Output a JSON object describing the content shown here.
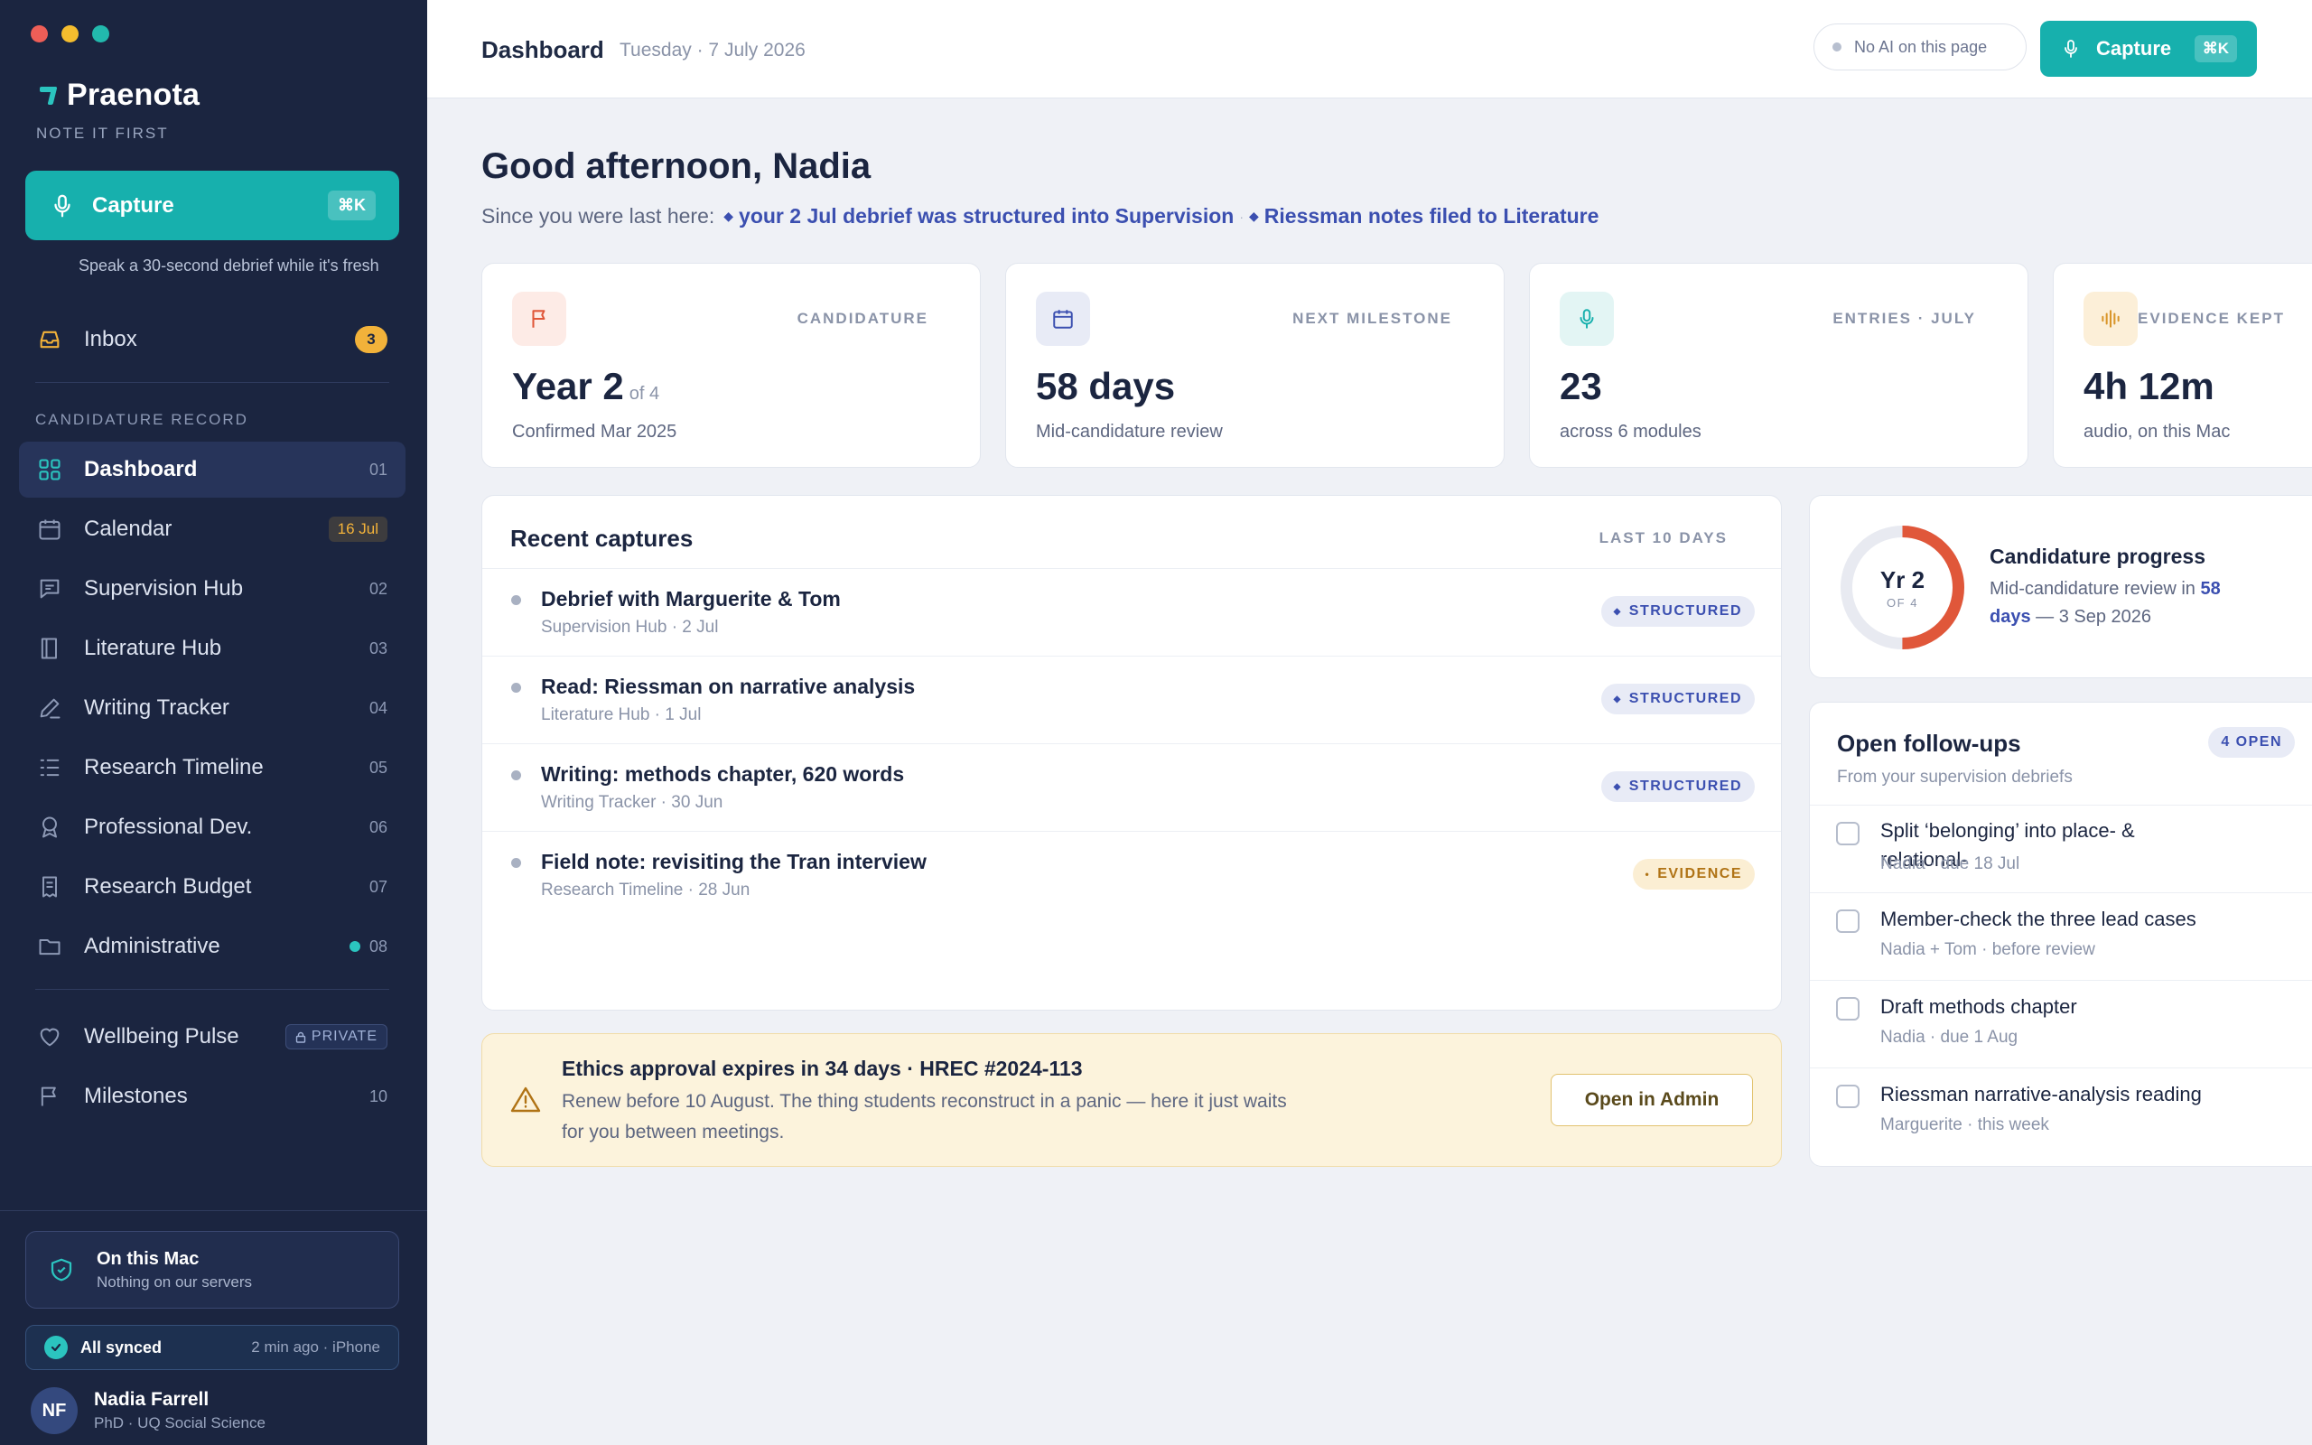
{
  "app": {
    "name": "Praenota",
    "tagline": "NOTE IT FIRST",
    "capture_label": "Capture",
    "capture_shortcut": "⌘K",
    "capture_hint": "Speak a 30-second debrief while it's fresh"
  },
  "sidebar": {
    "inbox": {
      "label": "Inbox",
      "count": "3"
    },
    "section_label": "CANDIDATURE RECORD",
    "items": [
      {
        "label": "Dashboard",
        "num": "01"
      },
      {
        "label": "Calendar",
        "num": "16 Jul"
      },
      {
        "label": "Supervision Hub",
        "num": "02"
      },
      {
        "label": "Literature Hub",
        "num": "03"
      },
      {
        "label": "Writing Tracker",
        "num": "04"
      },
      {
        "label": "Research Timeline",
        "num": "05"
      },
      {
        "label": "Professional Dev.",
        "num": "06"
      },
      {
        "label": "Research Budget",
        "num": "07"
      },
      {
        "label": "Administrative",
        "num": "08"
      }
    ],
    "wellbeing": {
      "label": "Wellbeing Pulse",
      "badge": "PRIVATE"
    },
    "milestones": {
      "label": "Milestones",
      "num": "10"
    },
    "mac_card": {
      "title": "On this Mac",
      "subtitle": "Nothing on our servers"
    },
    "sync": {
      "label": "All synced",
      "meta": "2 min ago · iPhone"
    },
    "user": {
      "initials": "NF",
      "name": "Nadia Farrell",
      "subtitle": "PhD · UQ Social Science"
    }
  },
  "topbar": {
    "title": "Dashboard",
    "date": "Tuesday · 7 July 2026",
    "no_ai": "No AI on this page",
    "capture_label": "Capture",
    "capture_shortcut": "⌘K"
  },
  "greeting": {
    "title": "Good afternoon, Nadia",
    "since_prefix": "Since you were last here:",
    "updates": [
      "your 2 Jul debrief was structured into Supervision",
      "Riessman notes filed to Literature"
    ]
  },
  "stats": [
    {
      "caption": "CANDIDATURE",
      "value": "Year 2",
      "value_suffix": "of 4",
      "sub": "Confirmed Mar 2025",
      "icon": "flag-icon"
    },
    {
      "caption": "NEXT MILESTONE",
      "value": "58 days",
      "value_suffix": "",
      "sub": "Mid-candidature review",
      "icon": "calendar-icon"
    },
    {
      "caption": "ENTRIES · JULY",
      "value": "23",
      "value_suffix": "",
      "sub": "across 6 modules",
      "icon": "mic-icon"
    },
    {
      "caption": "EVIDENCE KEPT",
      "value": "4h 12m",
      "value_suffix": "",
      "sub": "audio, on this Mac",
      "icon": "waveform-icon"
    }
  ],
  "recent": {
    "title": "Recent captures",
    "meta": "LAST 10 DAYS",
    "rows": [
      {
        "title": "Debrief with Marguerite & Tom",
        "sub": "Supervision Hub · 2 Jul",
        "tag": "STRUCTURED"
      },
      {
        "title": "Read: Riessman on narrative analysis",
        "sub": "Literature Hub · 1 Jul",
        "tag": "STRUCTURED"
      },
      {
        "title": "Writing: methods chapter, 620 words",
        "sub": "Writing Tracker · 30 Jun",
        "tag": "STRUCTURED"
      },
      {
        "title": "Field note: revisiting the Tran interview",
        "sub": "Research Timeline · 28 Jun",
        "tag": "EVIDENCE"
      }
    ]
  },
  "ethics": {
    "title": "Ethics approval expires in 34 days · HREC #2024-113",
    "body": "Renew before 10 August. The thing students reconstruct in a panic — here it just waits for you between meetings.",
    "button": "Open in Admin"
  },
  "progress": {
    "ring_big": "Yr 2",
    "ring_small": "OF 4",
    "fraction": 0.5,
    "title": "Candidature progress",
    "body_prefix": "Mid-candidature review in",
    "body_highlight": "58 days",
    "body_suffix": "— 3 Sep 2026"
  },
  "followups": {
    "title": "Open follow-ups",
    "subtitle": "From your supervision debriefs",
    "badge": "4 OPEN",
    "rows": [
      {
        "title": "Split ‘belonging’ into place- & relational-",
        "sub": "Nadia · due 18 Jul"
      },
      {
        "title": "Member-check the three lead cases",
        "sub": "Nadia + Tom · before review"
      },
      {
        "title": "Draft methods chapter",
        "sub": "Nadia · due 1 Aug"
      },
      {
        "title": "Riessman narrative-analysis reading",
        "sub": "Marguerite · this week"
      }
    ]
  },
  "colors": {
    "accent": "#17b0ad",
    "sidebar": "#1b2540",
    "link": "#3b4fb0",
    "progress_ring": "#e0573a"
  }
}
